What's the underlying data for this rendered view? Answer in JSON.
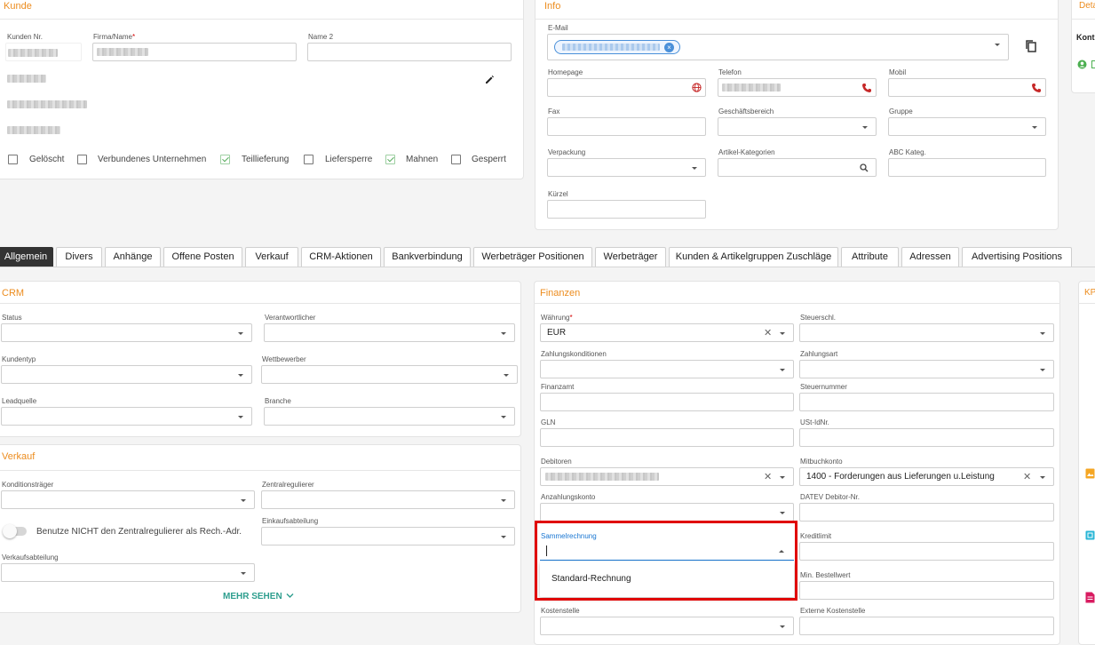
{
  "kunde": {
    "title": "Kunde",
    "kunden_nr_label": "Kunden Nr.",
    "firma_label": "Firma/Name",
    "name2_label": "Name 2",
    "checkboxes": [
      {
        "label": "Gelöscht",
        "checked": false
      },
      {
        "label": "Verbundenes Unternehmen",
        "checked": false
      },
      {
        "label": "Teillieferung",
        "checked": true
      },
      {
        "label": "Liefersperre",
        "checked": false
      },
      {
        "label": "Mahnen",
        "checked": true
      },
      {
        "label": "Gesperrt",
        "checked": false
      }
    ]
  },
  "info": {
    "title": "Info",
    "email_label": "E-Mail",
    "homepage_label": "Homepage",
    "telefon_label": "Telefon",
    "mobil_label": "Mobil",
    "fax_label": "Fax",
    "geschaeftsbereich_label": "Geschäftsbereich",
    "gruppe_label": "Gruppe",
    "verpackung_label": "Verpackung",
    "artikel_kategorien_label": "Artikel-Kategorien",
    "abc_label": "ABC Kateg.",
    "kuerzel_label": "Kürzel"
  },
  "details": {
    "title": "Deta",
    "kontakt": "Kont"
  },
  "tabs": [
    {
      "label": "Allgemein",
      "active": true
    },
    {
      "label": "Divers"
    },
    {
      "label": "Anhänge"
    },
    {
      "label": "Offene Posten"
    },
    {
      "label": "Verkauf"
    },
    {
      "label": "CRM-Aktionen"
    },
    {
      "label": "Bankverbindung"
    },
    {
      "label": "Werbeträger Positionen"
    },
    {
      "label": "Werbeträger"
    },
    {
      "label": "Kunden & Artikelgruppen Zuschläge"
    },
    {
      "label": "Attribute"
    },
    {
      "label": "Adressen"
    },
    {
      "label": "Advertising Positions"
    }
  ],
  "crm": {
    "title": "CRM",
    "status_label": "Status",
    "verantwortlicher_label": "Verantwortlicher",
    "kundentyp_label": "Kundentyp",
    "wettbewerber_label": "Wettbewerber",
    "leadquelle_label": "Leadquelle",
    "branche_label": "Branche"
  },
  "verkauf": {
    "title": "Verkauf",
    "konditionstraeger_label": "Konditionsträger",
    "zentralregulierer_label": "Zentralregulierer",
    "toggle_label": "Benutze NICHT den Zentralregulierer als Rech.-Adr.",
    "einkaufsabteilung_label": "Einkaufsabteilung",
    "verkaufsabteilung_label": "Verkaufsabteilung",
    "mehr_sehen": "MEHR SEHEN"
  },
  "finanzen": {
    "title": "Finanzen",
    "waehrung_label": "Währung",
    "waehrung_value": "EUR",
    "steuerschl_label": "Steuerschl.",
    "zahlungskonditionen_label": "Zahlungskonditionen",
    "zahlungsart_label": "Zahlungsart",
    "finanzamt_label": "Finanzamt",
    "steuernummer_label": "Steuernummer",
    "gln_label": "GLN",
    "ustid_label": "USt-IdNr.",
    "debitoren_label": "Debitoren",
    "mitbuchkonto_label": "Mitbuchkonto",
    "mitbuchkonto_value": "1400 - Forderungen aus Lieferungen u.Leistung",
    "anzahlungskonto_label": "Anzahlungskonto",
    "datev_label": "DATEV Debitor-Nr.",
    "sammelrechnung_label": "Sammelrechnung",
    "sammelrechnung_option": "Standard-Rechnung",
    "kreditlimit_label": "Kreditlimit",
    "min_bestellwert_label": "Min. Bestellwert",
    "kostenstelle_label": "Kostenstelle",
    "externe_kostenstelle_label": "Externe Kostenstelle"
  },
  "kpi": {
    "title": "KPI"
  },
  "colors": {
    "accent": "#ec8c1e",
    "highlight": "#e00000",
    "teal": "#2e9e8e"
  }
}
